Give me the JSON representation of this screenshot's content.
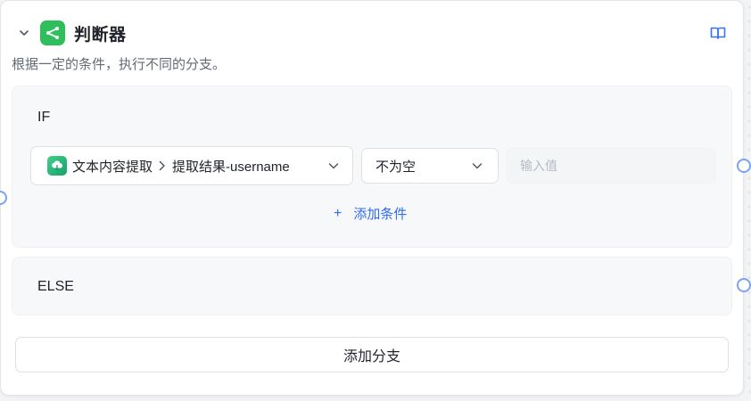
{
  "node": {
    "title": "判断器",
    "description": "根据一定的条件，执行不同的分支。",
    "icon": "branch-icon",
    "icon_color": "#2fbe5c"
  },
  "if_branch": {
    "label": "IF",
    "condition": {
      "variable_source": "文本内容提取",
      "variable_field": "提取结果-username",
      "variable_icon": "text-extract-icon",
      "operator": "不为空",
      "value": "",
      "value_placeholder": "输入值"
    },
    "add_condition_label": "添加条件"
  },
  "else_branch": {
    "label": "ELSE"
  },
  "add_branch_label": "添加分支",
  "colors": {
    "accent": "#2f6bf5",
    "port": "#7aa3f5"
  }
}
